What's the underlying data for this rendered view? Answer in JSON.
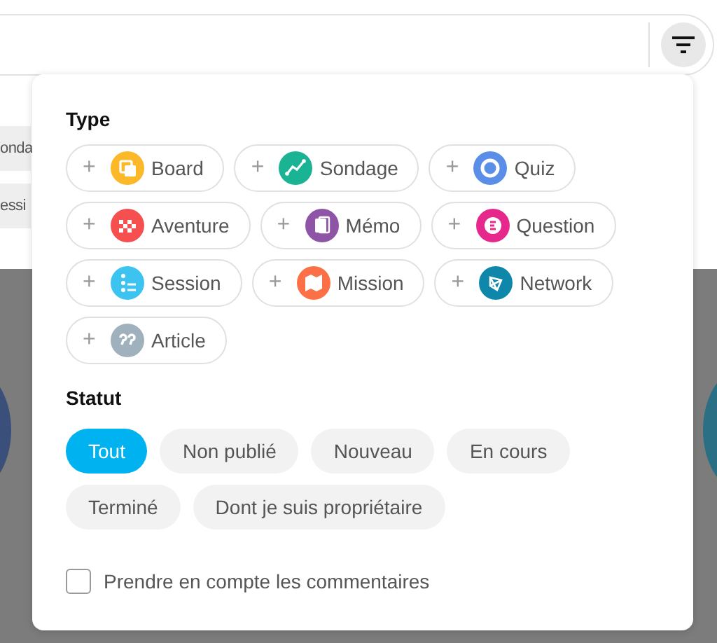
{
  "background_chips": [
    "onda",
    "essi"
  ],
  "filter_popup": {
    "type_title": "Type",
    "types": [
      {
        "label": "Board",
        "kind": "board",
        "color": "#fbb829",
        "selected": false
      },
      {
        "label": "Sondage",
        "kind": "poll",
        "color": "#1ab394",
        "selected": false
      },
      {
        "label": "Quiz",
        "kind": "quiz",
        "color": "#5b8ee6",
        "selected": false
      },
      {
        "label": "Aventure",
        "kind": "adventure",
        "color": "#f5504f",
        "selected": false
      },
      {
        "label": "Mémo",
        "kind": "memo",
        "color": "#8e55a6",
        "selected": false
      },
      {
        "label": "Question",
        "kind": "question",
        "color": "#e6288c",
        "selected": false
      },
      {
        "label": "Session",
        "kind": "session",
        "color": "#3dc3f0",
        "selected": false
      },
      {
        "label": "Mission",
        "kind": "mission",
        "color": "#fb7047",
        "selected": false
      },
      {
        "label": "Network",
        "kind": "network",
        "color": "#0e87ab",
        "selected": false
      },
      {
        "label": "Article",
        "kind": "article",
        "color": "#9fb1bd",
        "selected": false
      }
    ],
    "type_add_symbol": "+",
    "status_title": "Statut",
    "statuses": [
      {
        "label": "Tout",
        "selected": true
      },
      {
        "label": "Non publié",
        "selected": false
      },
      {
        "label": "Nouveau",
        "selected": false
      },
      {
        "label": "En cours",
        "selected": false
      },
      {
        "label": "Terminé",
        "selected": false
      },
      {
        "label": "Dont je suis propriétaire",
        "selected": false
      }
    ],
    "comments_checkbox": {
      "label": "Prendre en compte les commentaires",
      "checked": false
    }
  }
}
